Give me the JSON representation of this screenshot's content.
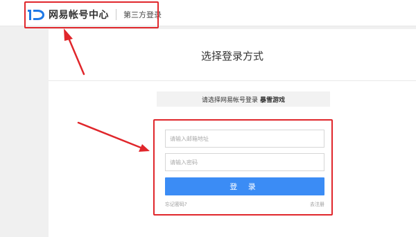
{
  "header": {
    "brand_title": "网易帐号中心",
    "sub_title": "第三方登录"
  },
  "main": {
    "title": "选择登录方式",
    "notice_prefix": "请选择网易帐号登录",
    "notice_game": "暴雪游戏"
  },
  "login_form": {
    "email_placeholder": "请输入邮箱地址",
    "password_placeholder": "请输入密码",
    "login_button": "登 录",
    "forgot_password": "忘记密码?",
    "register": "去注册"
  },
  "colors": {
    "accent_blue": "#3b8cf5",
    "highlight_red": "#e0262b",
    "logo_blue": "#1e78e6"
  },
  "icons": {
    "brand_logo": "netease-id-logo-icon",
    "arrows": "red-annotation-arrow-icon"
  }
}
